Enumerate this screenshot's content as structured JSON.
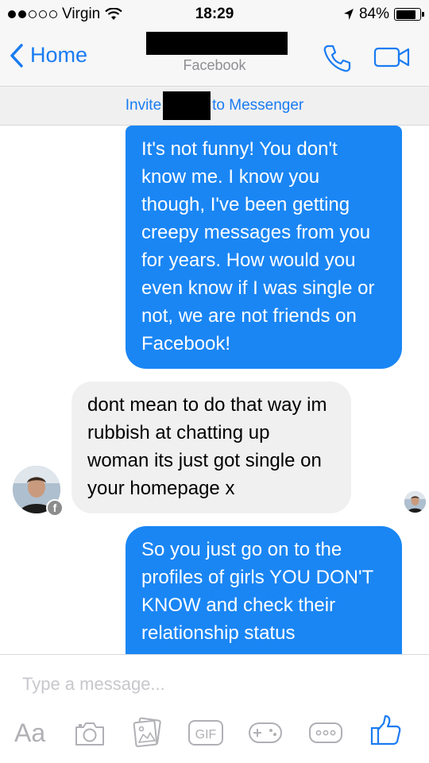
{
  "status_bar": {
    "carrier": "Virgin",
    "time": "18:29",
    "battery": "84%",
    "battery_level": 0.84
  },
  "nav": {
    "back_label": "Home",
    "subtitle": "Facebook"
  },
  "invite_bar": {
    "before": "Invite",
    "after": "to Messenger"
  },
  "messages": [
    {
      "from": "me",
      "text": "It's not funny! You don't know me. I know you though, I've been getting creepy messages from you for years. How would you even know if I was single or not, we are not friends on Facebook!"
    },
    {
      "from": "them",
      "text": "dont mean to do that way im rubbish at chatting up woman its just got single on your homepage x"
    },
    {
      "from": "me",
      "text": "So you just go on to the profiles of girls YOU DON'T KNOW and check their relationship status"
    }
  ],
  "composer": {
    "placeholder": "Type a message...",
    "aa_label": "Aa",
    "gif_label": "GIF"
  },
  "colors": {
    "accent": "#1a7bf2",
    "my_bubble": "#1a86f4",
    "their_bubble": "#f0f0f0"
  },
  "icons": [
    "wifi-icon",
    "location-arrow-icon",
    "battery-icon",
    "chevron-left-icon",
    "phone-icon",
    "video-icon",
    "camera-icon",
    "photo-icon",
    "gif-icon",
    "game-controller-icon",
    "more-icon",
    "thumbs-up-icon",
    "facebook-badge-icon"
  ]
}
